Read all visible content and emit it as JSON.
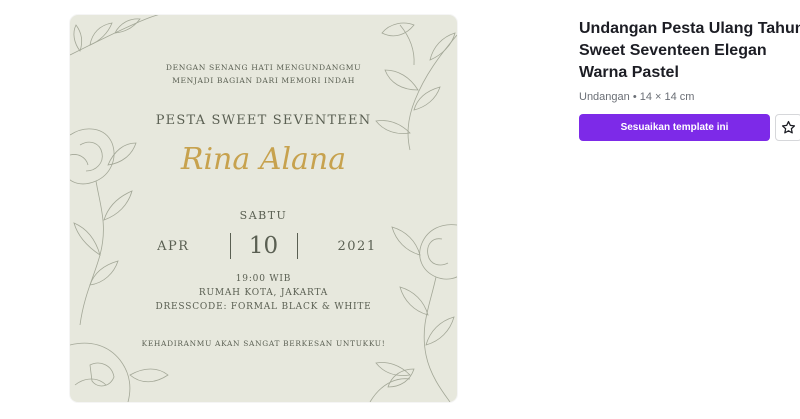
{
  "template": {
    "title": "Undangan Pesta Ulang Tahun Sweet Seventeen Elegan Warna Pastel",
    "meta": "Undangan • 14 × 14 cm",
    "cta_label": "Sesuaikan template ini",
    "favorite_icon": "star-outline-icon",
    "accent_color": "#7d2ae8"
  },
  "invitation": {
    "intro_line1": "DENGAN SENANG HATI MENGUNDANGMU",
    "intro_line2": "MENJADI BAGIAN DARI MEMORI INDAH",
    "event": "PESTA SWEET SEVENTEEN",
    "name": "Rina Alana",
    "day": "SABTU",
    "month": "APR",
    "date": "10",
    "year": "2021",
    "time": "19:00 WIB",
    "venue": "RUMAH KOTA, JAKARTA",
    "dresscode": "DRESSCODE: FORMAL BLACK & WHITE",
    "closing": "KEHADIRANMU AKAN SANGAT BERKESAN UNTUKKU!",
    "background_color": "#e7e8dd",
    "name_color": "#c7a24e"
  }
}
